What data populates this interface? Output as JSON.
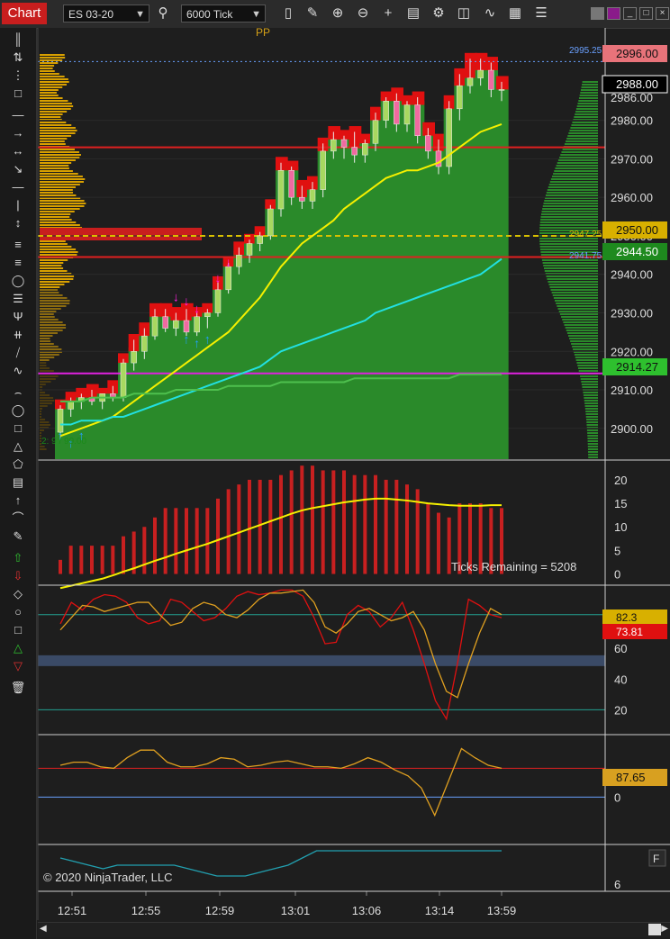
{
  "toolbar": {
    "chart_tab": "Chart",
    "instrument": "ES 03-20",
    "interval": "6000 Tick",
    "icons": [
      "search-icon",
      "bar-type-icon",
      "pencil-icon",
      "zoom-in-icon",
      "zoom-out-icon",
      "crosshair-icon",
      "properties-icon",
      "strategies-icon",
      "indicators-icon",
      "templates-icon"
    ],
    "window_buttons": [
      "minimize",
      "maximize",
      "close"
    ]
  },
  "drawing_tools": [
    "ruler",
    "arrow-line",
    "ray",
    "extended-line",
    "line",
    "horizontal-line",
    "vertical-line",
    "fib-retracement",
    "fib-extension",
    "gann-fan",
    "andrews-pitchfork",
    "regression",
    "arc",
    "ellipse",
    "rectangle",
    "triangle",
    "polygon",
    "text",
    "path",
    "arrow-up",
    "arrow-down",
    "diamond",
    "dot",
    "square",
    "triangle-up",
    "triangle-down",
    "remove-all"
  ],
  "price_labels": {
    "top": "2996.00",
    "last": "2988.00",
    "yellow": "2950.00",
    "green1": "2944.50",
    "green2": "2914.27",
    "small1": "2995.25",
    "small2": "2947.25",
    "small3": "2941.75",
    "profile_note": "2: 9 / 99.00",
    "pp_label": "PP"
  },
  "panel_labels": {
    "ticks_remaining": "Ticks Remaining = 5208",
    "osc1_yellow": "82.3",
    "osc1_red": "73.81",
    "osc2_label": "87.65",
    "copyright": "© 2020 NinjaTrader, LLC",
    "f_button": "F"
  },
  "chart_data": [
    {
      "type": "line",
      "panel": "price",
      "instrument": "ES 03-20",
      "ylim": [
        2892,
        3004
      ],
      "yticks": [
        2900,
        2910,
        2920,
        2930,
        2940,
        2950,
        2960,
        2970,
        2980
      ],
      "x": [
        "12:51",
        "12:55",
        "12:59",
        "13:01",
        "13:06",
        "13:14",
        "13:59"
      ],
      "candles": [
        {
          "o": 2899,
          "h": 2906,
          "l": 2897,
          "c": 2905
        },
        {
          "o": 2905,
          "h": 2908,
          "l": 2903,
          "c": 2907
        },
        {
          "o": 2907,
          "h": 2909,
          "l": 2905,
          "c": 2908
        },
        {
          "o": 2908,
          "h": 2910,
          "l": 2906,
          "c": 2907
        },
        {
          "o": 2907,
          "h": 2909,
          "l": 2905,
          "c": 2909
        },
        {
          "o": 2909,
          "h": 2911,
          "l": 2907,
          "c": 2908
        },
        {
          "o": 2908,
          "h": 2918,
          "l": 2907,
          "c": 2917
        },
        {
          "o": 2917,
          "h": 2923,
          "l": 2915,
          "c": 2920
        },
        {
          "o": 2920,
          "h": 2926,
          "l": 2918,
          "c": 2924
        },
        {
          "o": 2924,
          "h": 2931,
          "l": 2923,
          "c": 2929
        },
        {
          "o": 2929,
          "h": 2931,
          "l": 2925,
          "c": 2926
        },
        {
          "o": 2926,
          "h": 2930,
          "l": 2924,
          "c": 2928
        },
        {
          "o": 2928,
          "h": 2931,
          "l": 2924,
          "c": 2925
        },
        {
          "o": 2925,
          "h": 2930,
          "l": 2924,
          "c": 2929
        },
        {
          "o": 2929,
          "h": 2931,
          "l": 2926,
          "c": 2930
        },
        {
          "o": 2930,
          "h": 2938,
          "l": 2929,
          "c": 2936
        },
        {
          "o": 2936,
          "h": 2943,
          "l": 2935,
          "c": 2942
        },
        {
          "o": 2942,
          "h": 2947,
          "l": 2940,
          "c": 2945
        },
        {
          "o": 2945,
          "h": 2949,
          "l": 2943,
          "c": 2948
        },
        {
          "o": 2948,
          "h": 2951,
          "l": 2946,
          "c": 2950
        },
        {
          "o": 2950,
          "h": 2958,
          "l": 2949,
          "c": 2957
        },
        {
          "o": 2957,
          "h": 2969,
          "l": 2955,
          "c": 2967
        },
        {
          "o": 2967,
          "h": 2968,
          "l": 2958,
          "c": 2960
        },
        {
          "o": 2960,
          "h": 2963,
          "l": 2957,
          "c": 2959
        },
        {
          "o": 2959,
          "h": 2964,
          "l": 2957,
          "c": 2962
        },
        {
          "o": 2962,
          "h": 2974,
          "l": 2960,
          "c": 2972
        },
        {
          "o": 2972,
          "h": 2977,
          "l": 2970,
          "c": 2975
        },
        {
          "o": 2975,
          "h": 2976,
          "l": 2970,
          "c": 2973
        },
        {
          "o": 2973,
          "h": 2977,
          "l": 2969,
          "c": 2971
        },
        {
          "o": 2971,
          "h": 2975,
          "l": 2969,
          "c": 2974
        },
        {
          "o": 2974,
          "h": 2982,
          "l": 2972,
          "c": 2980
        },
        {
          "o": 2980,
          "h": 2986,
          "l": 2978,
          "c": 2985
        },
        {
          "o": 2985,
          "h": 2987,
          "l": 2977,
          "c": 2979
        },
        {
          "o": 2979,
          "h": 2985,
          "l": 2977,
          "c": 2984
        },
        {
          "o": 2984,
          "h": 2986,
          "l": 2974,
          "c": 2976
        },
        {
          "o": 2976,
          "h": 2978,
          "l": 2970,
          "c": 2972
        },
        {
          "o": 2972,
          "h": 2975,
          "l": 2966,
          "c": 2968
        },
        {
          "o": 2968,
          "h": 2985,
          "l": 2966,
          "c": 2983
        },
        {
          "o": 2983,
          "h": 2992,
          "l": 2980,
          "c": 2989
        },
        {
          "o": 2989,
          "h": 2996,
          "l": 2987,
          "c": 2991
        },
        {
          "o": 2991,
          "h": 2996,
          "l": 2989,
          "c": 2993
        },
        {
          "o": 2993,
          "h": 2995,
          "l": 2986,
          "c": 2988
        },
        {
          "o": 2988,
          "h": 2990,
          "l": 2985,
          "c": 2988
        }
      ],
      "series": [
        {
          "name": "yellow-ma",
          "color": "#f5f000",
          "values": [
            2898,
            2899,
            2900,
            2901,
            2902,
            2903,
            2905,
            2907,
            2909,
            2911,
            2913,
            2915,
            2917,
            2919,
            2921,
            2923,
            2925,
            2928,
            2931,
            2934,
            2938,
            2942,
            2945,
            2948,
            2950,
            2952,
            2954,
            2957,
            2959,
            2961,
            2963,
            2965,
            2966,
            2967,
            2967,
            2968,
            2969,
            2971,
            2973,
            2975,
            2977,
            2978,
            2979
          ]
        },
        {
          "name": "cyan-ma",
          "color": "#22e0e0",
          "values": [
            2901,
            2901,
            2902,
            2902,
            2902,
            2903,
            2903,
            2904,
            2905,
            2906,
            2907,
            2908,
            2909,
            2910,
            2911,
            2912,
            2913,
            2914,
            2915,
            2916,
            2918,
            2920,
            2921,
            2922,
            2923,
            2924,
            2925,
            2926,
            2927,
            2928,
            2930,
            2931,
            2932,
            2933,
            2934,
            2935,
            2936,
            2937,
            2938,
            2939,
            2940,
            2942,
            2944
          ]
        },
        {
          "name": "green-ma",
          "color": "#4ec04e",
          "values": [
            2907,
            2907,
            2907,
            2908,
            2908,
            2908,
            2908,
            2909,
            2909,
            2909,
            2909,
            2910,
            2910,
            2910,
            2910,
            2910,
            2911,
            2911,
            2911,
            2911,
            2911,
            2912,
            2912,
            2912,
            2912,
            2912,
            2912,
            2912,
            2913,
            2913,
            2913,
            2913,
            2913,
            2913,
            2913,
            2913,
            2913,
            2913,
            2914,
            2914,
            2914,
            2914,
            2914
          ]
        }
      ],
      "horizontal_lines": [
        {
          "value": 2914.27,
          "color": "#e020e0"
        },
        {
          "value": 2944.5,
          "color": "#e02020"
        },
        {
          "value": 2973.0,
          "color": "#e02020"
        },
        {
          "value": 2950.0,
          "color": "#d8c000",
          "dashed": true
        },
        {
          "value": 2995.25,
          "color": "#6aa0ff",
          "dotted": true
        }
      ]
    },
    {
      "type": "bar",
      "panel": "volume",
      "ylim": [
        -2,
        24
      ],
      "yticks": [
        0,
        5,
        10,
        15,
        20
      ],
      "values": [
        3,
        6,
        6,
        6,
        6,
        6,
        8,
        9,
        10,
        12,
        14,
        14,
        14,
        14,
        14,
        16,
        18,
        19,
        20,
        20,
        20,
        21,
        22,
        23,
        23,
        22,
        22,
        22,
        21,
        21,
        21,
        20,
        20,
        19,
        18,
        15,
        13,
        12,
        15,
        15,
        15,
        14,
        14
      ],
      "series": [
        {
          "name": "volume-ma",
          "color": "#f5f000",
          "values": [
            -3,
            -2.5,
            -2,
            -1.5,
            -1,
            -0.3,
            0.5,
            1.2,
            2,
            2.8,
            3.5,
            4.3,
            5,
            5.7,
            6.4,
            7.2,
            8,
            8.8,
            9.6,
            10.4,
            11.2,
            12,
            12.8,
            13.5,
            14,
            14.4,
            14.8,
            15.2,
            15.5,
            15.8,
            16,
            16,
            15.8,
            15.6,
            15.3,
            15,
            14.8,
            14.6,
            14.5,
            14.5,
            14.5,
            14.6,
            14.6
          ]
        }
      ]
    },
    {
      "type": "line",
      "panel": "oscillator-1",
      "ylim": [
        5,
        100
      ],
      "yticks": [
        20,
        40,
        60
      ],
      "series": [
        {
          "name": "red-line",
          "color": "#e01010",
          "values": [
            76,
            90,
            85,
            92,
            95,
            94,
            90,
            80,
            76,
            78,
            92,
            90,
            84,
            78,
            80,
            86,
            94,
            97,
            95,
            96,
            98,
            98,
            94,
            80,
            63,
            64,
            82,
            88,
            84,
            74,
            80,
            90,
            72,
            50,
            26,
            14,
            50,
            92,
            88,
            82,
            80
          ]
        },
        {
          "name": "yellow-line",
          "color": "#e0a020",
          "values": [
            72,
            80,
            88,
            87,
            84,
            86,
            88,
            90,
            90,
            82,
            75,
            77,
            86,
            90,
            88,
            82,
            80,
            85,
            92,
            96,
            96,
            97,
            98,
            90,
            74,
            70,
            76,
            84,
            86,
            82,
            78,
            80,
            84,
            72,
            50,
            32,
            28,
            50,
            70,
            86,
            82
          ]
        }
      ],
      "horizontal_lines": [
        {
          "value": 82,
          "color": "#22a090"
        },
        {
          "value": 20,
          "color": "#22a090"
        },
        {
          "value": 52,
          "color": "#3a4a66",
          "band": true
        }
      ]
    },
    {
      "type": "line",
      "panel": "oscillator-2",
      "ylim": [
        -15,
        20
      ],
      "yticks": [
        0
      ],
      "series": [
        {
          "name": "orange-line",
          "color": "#e0a020",
          "values": [
            10.5,
            11.5,
            11.5,
            10,
            9.5,
            13,
            15.5,
            15.5,
            11.5,
            10,
            10,
            11,
            13,
            12.5,
            10,
            10.5,
            11.5,
            12,
            11,
            10,
            10,
            9.5,
            11,
            13,
            11.5,
            9,
            7,
            3,
            -6,
            5,
            16,
            13,
            10.5,
            9.5
          ]
        }
      ],
      "horizontal_lines": [
        {
          "value": 9.5,
          "color": "#e02020"
        },
        {
          "value": 0,
          "color": "#6aa0ff"
        }
      ]
    },
    {
      "type": "line",
      "panel": "oscillator-3",
      "yticks": [
        6
      ],
      "series": [
        {
          "name": "teal-line",
          "color": "#22a0b0",
          "values": [
            2,
            3,
            4,
            5,
            4,
            4,
            4,
            4,
            4,
            5,
            6,
            7,
            7,
            7,
            6,
            5,
            4,
            2,
            0,
            0,
            0,
            0,
            0,
            0,
            0,
            0,
            0,
            0,
            0,
            0,
            0,
            0
          ]
        }
      ]
    }
  ]
}
